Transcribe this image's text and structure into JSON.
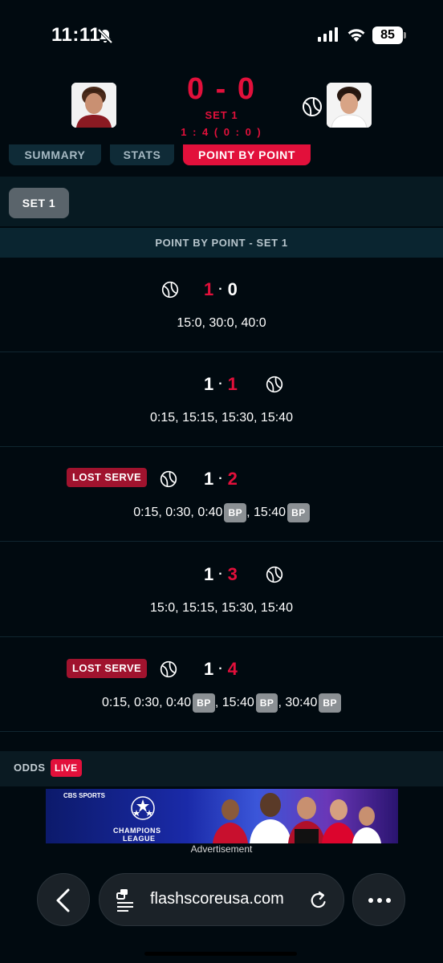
{
  "status_bar": {
    "time": "11:11",
    "battery": "85"
  },
  "match": {
    "score": "0 - 0",
    "set_label": "SET 1",
    "game_score": "1 : 4 ( 0 : 0 )"
  },
  "tabs": [
    {
      "label": "SUMMARY",
      "active": false
    },
    {
      "label": "STATS",
      "active": false
    },
    {
      "label": "POINT BY POINT",
      "active": true
    }
  ],
  "set_selector": {
    "label": "SET 1"
  },
  "section_title": "POINT BY POINT - SET 1",
  "lost_serve_label": "LOST SERVE",
  "bp_label": "BP",
  "games": [
    {
      "home": "1",
      "away": "0",
      "highlight": "home",
      "server": "home",
      "lost_serve": false,
      "points": [
        "15:0, 30:0, 40:0"
      ]
    },
    {
      "home": "1",
      "away": "1",
      "highlight": "away",
      "server": "away",
      "lost_serve": false,
      "points": [
        "0:15, 15:15, 15:30, 15:40"
      ]
    },
    {
      "home": "1",
      "away": "2",
      "highlight": "away",
      "server": "home",
      "lost_serve": true,
      "points": [
        "0:15, 0:30, 0:40",
        "BP",
        ", 15:40",
        "BP"
      ]
    },
    {
      "home": "1",
      "away": "3",
      "highlight": "away",
      "server": "away",
      "lost_serve": false,
      "points": [
        "15:0, 15:15, 15:30, 15:40"
      ]
    },
    {
      "home": "1",
      "away": "4",
      "highlight": "away",
      "server": "home",
      "lost_serve": true,
      "points": [
        "0:15, 0:30, 0:40",
        "BP",
        ", 15:40",
        "BP",
        ", 30:40",
        "BP"
      ]
    }
  ],
  "odds": {
    "label": "ODDS",
    "live": "LIVE"
  },
  "ad": {
    "sponsor": "CBS SPORTS",
    "line1": "CHAMPIONS",
    "line2": "LEAGUE",
    "caption": "Advertisement"
  },
  "browser": {
    "url": "flashscoreusa.com"
  },
  "colors": {
    "accent": "#e2103b",
    "background": "#010a10",
    "lost_serve": "#a0132e",
    "bp_badge": "#8b9094"
  }
}
